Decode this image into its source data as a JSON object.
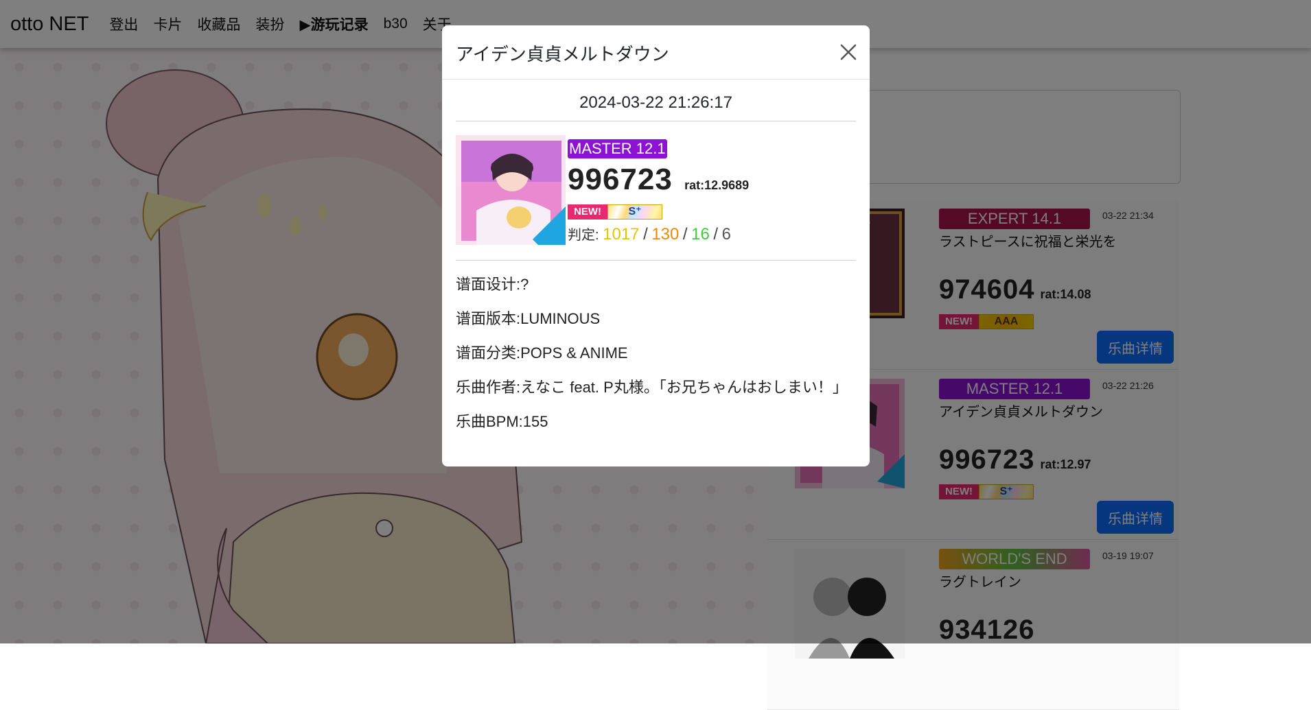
{
  "navbar": {
    "brand": "otto NET",
    "links": [
      "登出",
      "卡片",
      "收藏品",
      "装扮",
      "▶游玩记录",
      "b30",
      "关于"
    ]
  },
  "records": [
    {
      "difficulty": "EXPERT 14.1",
      "difficulty_color": "#a9154b",
      "time": "03-22 21:34",
      "title": "ラストピースに祝福と栄光を",
      "score": "974604",
      "rating": "rat:14.08",
      "new_badge": "NEW!",
      "rank": "AAA",
      "detail_button": "乐曲详情"
    },
    {
      "difficulty": "MASTER 12.1",
      "difficulty_color": "#8d12d4",
      "time": "03-22 21:26",
      "title": "アイデン貞貞メルトダウン",
      "score": "996723",
      "rating": "rat:12.97",
      "new_badge": "NEW!",
      "rank": "S⁺",
      "detail_button": "乐曲详情"
    },
    {
      "difficulty": "WORLD'S END",
      "difficulty_color": "#e58fc0",
      "time": "03-19 19:07",
      "title": "ラグトレイン",
      "score": "934126"
    }
  ],
  "modal": {
    "title": "アイデン貞貞メルトダウン",
    "play_time": "2024-03-22 21:26:17",
    "difficulty": "MASTER 12.1",
    "score": "996723",
    "rating": "rat:12.9689",
    "new_badge": "NEW!",
    "rank": "S⁺",
    "judge_label": "判定:",
    "judge": {
      "critical": "1017",
      "justice": "130",
      "attack": "16",
      "miss": "6",
      "separator": "/"
    },
    "info": [
      "谱面设计:?",
      "谱面版本:LUMINOUS",
      "谱面分类:POPS & ANIME",
      "乐曲作者:えなこ feat. P丸様。「お兄ちゃんはおしまい！」",
      "乐曲BPM:155"
    ]
  }
}
